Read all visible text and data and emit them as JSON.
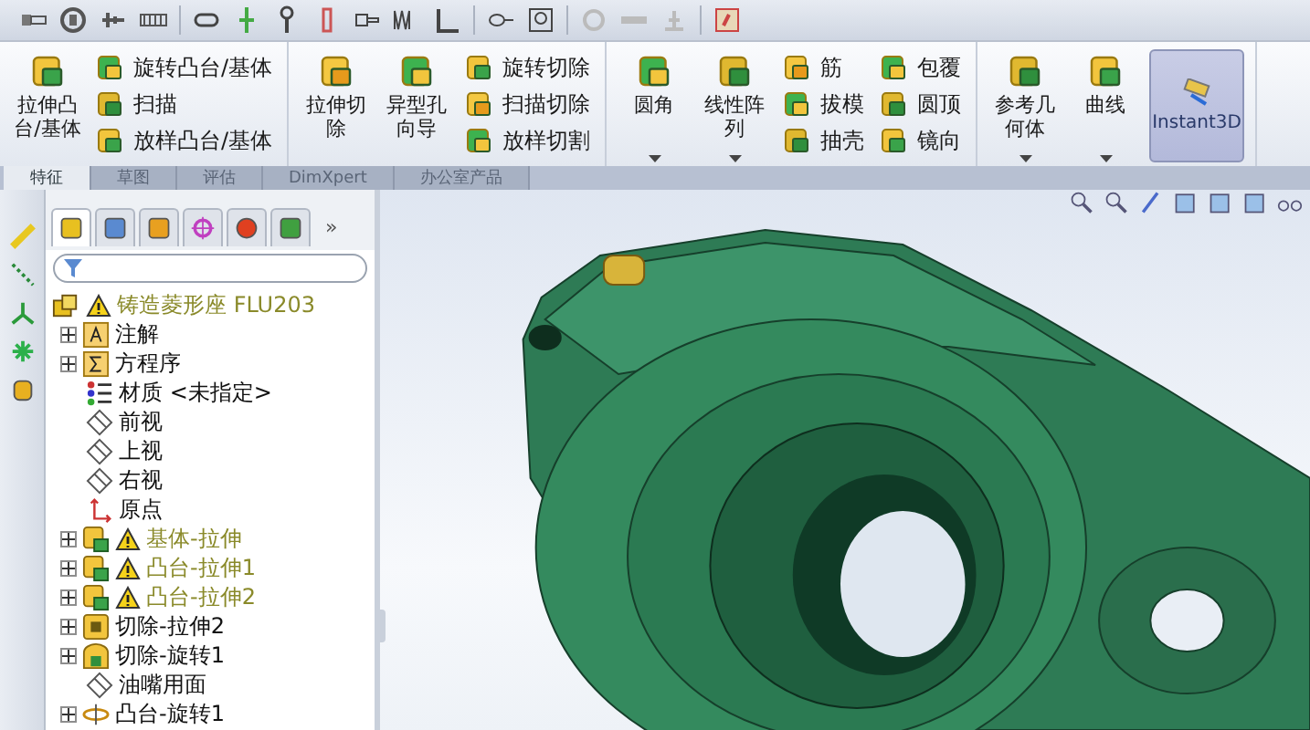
{
  "ribbon": {
    "groups": [
      {
        "columns": [
          {
            "kind": "large",
            "label": "拉伸凸台/基体",
            "dropdown": false
          },
          {
            "kind": "stack",
            "items": [
              {
                "label": "旋转凸台/基体"
              },
              {
                "label": "扫描"
              },
              {
                "label": "放样凸台/基体"
              }
            ]
          }
        ]
      },
      {
        "columns": [
          {
            "kind": "large",
            "label": "拉伸切除",
            "dropdown": false
          },
          {
            "kind": "large",
            "label": "异型孔向导",
            "dropdown": false
          },
          {
            "kind": "stack",
            "items": [
              {
                "label": "旋转切除"
              },
              {
                "label": "扫描切除"
              },
              {
                "label": "放样切割"
              }
            ]
          }
        ]
      },
      {
        "columns": [
          {
            "kind": "large",
            "label": "圆角",
            "dropdown": true
          },
          {
            "kind": "large",
            "label": "线性阵列",
            "dropdown": true
          },
          {
            "kind": "stack",
            "items": [
              {
                "label": "筋"
              },
              {
                "label": "拔模"
              },
              {
                "label": "抽壳"
              }
            ]
          },
          {
            "kind": "stack",
            "items": [
              {
                "label": "包覆"
              },
              {
                "label": "圆顶"
              },
              {
                "label": "镜向"
              }
            ]
          }
        ]
      },
      {
        "columns": [
          {
            "kind": "large",
            "label": "参考几何体",
            "dropdown": true
          },
          {
            "kind": "large",
            "label": "曲线",
            "dropdown": true
          },
          {
            "kind": "toggle",
            "label": "Instant3D",
            "on": true
          }
        ]
      }
    ]
  },
  "tabs": [
    {
      "label": "特征",
      "selected": true
    },
    {
      "label": "草图",
      "selected": false
    },
    {
      "label": "评估",
      "selected": false
    },
    {
      "label": "DimXpert",
      "selected": false
    },
    {
      "label": "办公室产品",
      "selected": false
    }
  ],
  "panel": {
    "more": "»",
    "tree": {
      "label": "铸造菱形座 FLU203",
      "warning": true,
      "children": [
        {
          "label": "注解",
          "kind": "annotation",
          "expandable": true,
          "warning": false
        },
        {
          "label": "方程序",
          "kind": "equation",
          "expandable": true,
          "warning": false
        },
        {
          "label": "材质 <未指定>",
          "kind": "material",
          "expandable": false,
          "warning": false
        },
        {
          "label": "前视",
          "kind": "plane",
          "expandable": false,
          "warning": false
        },
        {
          "label": "上视",
          "kind": "plane",
          "expandable": false,
          "warning": false
        },
        {
          "label": "右视",
          "kind": "plane",
          "expandable": false,
          "warning": false
        },
        {
          "label": "原点",
          "kind": "origin",
          "expandable": false,
          "warning": false
        },
        {
          "label": "基体-拉伸",
          "kind": "extrude",
          "expandable": true,
          "warning": true
        },
        {
          "label": "凸台-拉伸1",
          "kind": "extrude",
          "expandable": true,
          "warning": true
        },
        {
          "label": "凸台-拉伸2",
          "kind": "extrude",
          "expandable": true,
          "warning": true
        },
        {
          "label": "切除-拉伸2",
          "kind": "cut",
          "expandable": true,
          "warning": false
        },
        {
          "label": "切除-旋转1",
          "kind": "cutrevolve",
          "expandable": true,
          "warning": false
        },
        {
          "label": "油嘴用面",
          "kind": "plane",
          "expandable": false,
          "warning": false
        },
        {
          "label": "凸台-旋转1",
          "kind": "revolve",
          "expandable": true,
          "warning": false
        }
      ]
    }
  }
}
